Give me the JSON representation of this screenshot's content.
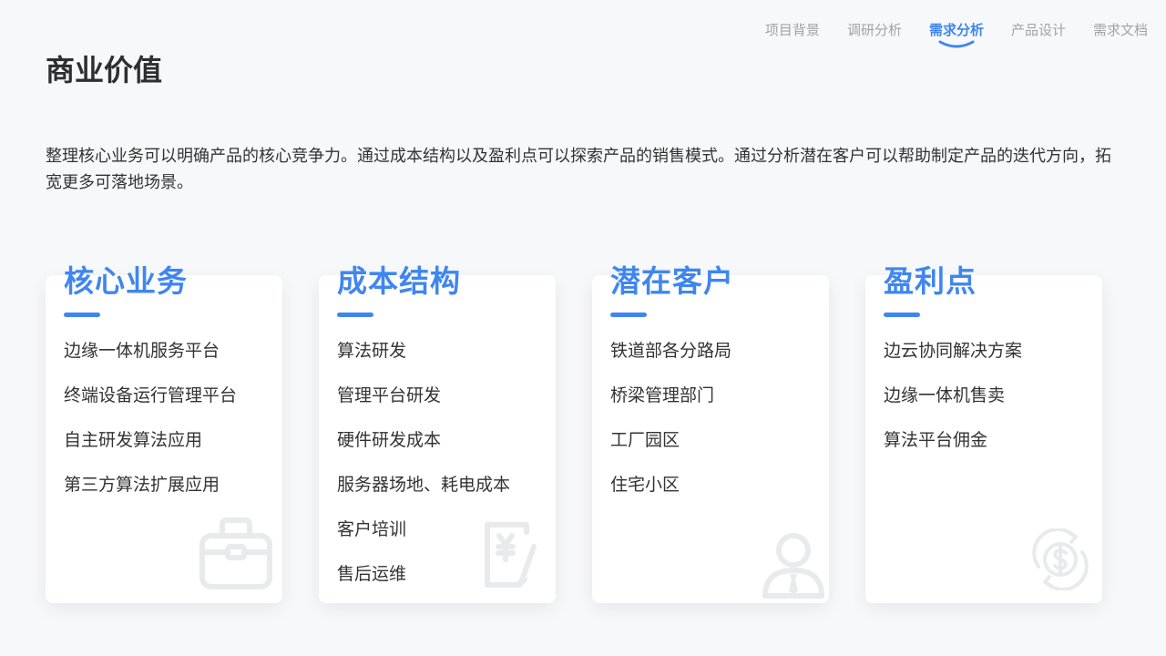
{
  "nav": {
    "items": [
      {
        "label": "项目背景"
      },
      {
        "label": "调研分析"
      },
      {
        "label": "需求分析"
      },
      {
        "label": "产品设计"
      },
      {
        "label": "需求文档"
      }
    ],
    "active_index": 2,
    "accent_color": "#3f86f0"
  },
  "page": {
    "title": "商业价值",
    "intro": "整理核心业务可以明确产品的核心竞争力。通过成本结构以及盈利点可以探索产品的销售模式。通过分析潜在客户可以帮助制定产品的迭代方向，拓宽更多可落地场景。"
  },
  "cards": [
    {
      "title": "核心业务",
      "icon": "briefcase-icon",
      "items": [
        "边缘一体机服务平台",
        "终端设备运行管理平台",
        "自主研发算法应用",
        "第三方算法扩展应用"
      ]
    },
    {
      "title": "成本结构",
      "icon": "receipt-yuan-icon",
      "items": [
        "算法研发",
        "管理平台研发",
        "硬件研发成本",
        "服务器场地、耗电成本",
        "客户培训",
        "售后运维"
      ]
    },
    {
      "title": "潜在客户",
      "icon": "user-icon",
      "items": [
        "铁道部各分路局",
        "桥梁管理部门",
        "工厂园区",
        "住宅小区"
      ]
    },
    {
      "title": "盈利点",
      "icon": "dollar-cycle-icon",
      "items": [
        "边云协同解决方案",
        "边缘一体机售卖",
        "算法平台佣金"
      ]
    }
  ]
}
